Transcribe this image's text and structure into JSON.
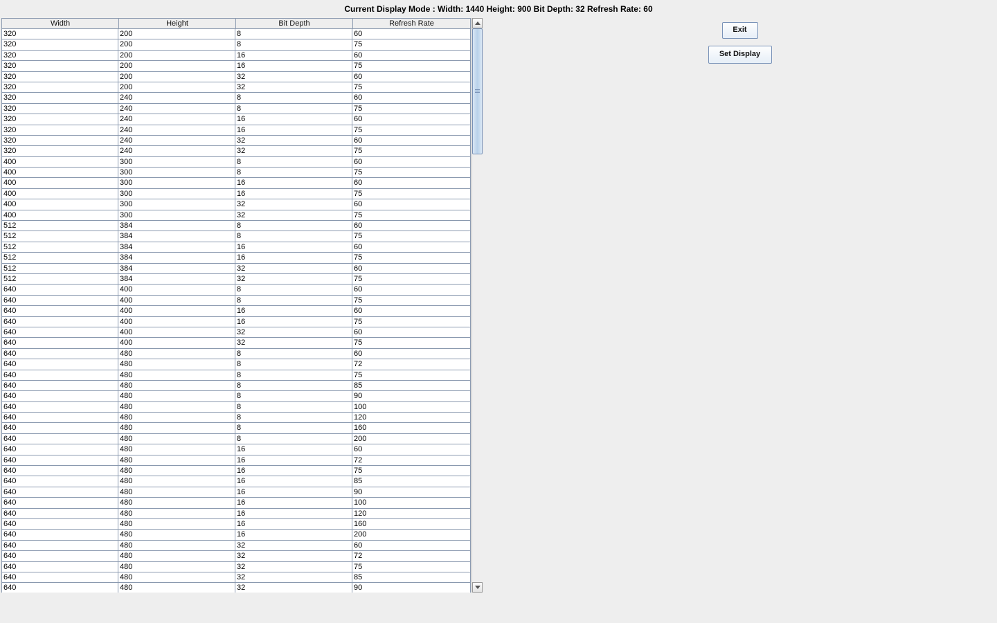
{
  "title": "Current Display Mode :   Width: 1440 Height: 900 Bit Depth: 32 Refresh Rate: 60",
  "buttons": {
    "exit": "Exit",
    "set_display": "Set Display"
  },
  "columns": [
    "Width",
    "Height",
    "Bit Depth",
    "Refresh Rate"
  ],
  "rows": [
    [
      "320",
      "200",
      "8",
      "60"
    ],
    [
      "320",
      "200",
      "8",
      "75"
    ],
    [
      "320",
      "200",
      "16",
      "60"
    ],
    [
      "320",
      "200",
      "16",
      "75"
    ],
    [
      "320",
      "200",
      "32",
      "60"
    ],
    [
      "320",
      "200",
      "32",
      "75"
    ],
    [
      "320",
      "240",
      "8",
      "60"
    ],
    [
      "320",
      "240",
      "8",
      "75"
    ],
    [
      "320",
      "240",
      "16",
      "60"
    ],
    [
      "320",
      "240",
      "16",
      "75"
    ],
    [
      "320",
      "240",
      "32",
      "60"
    ],
    [
      "320",
      "240",
      "32",
      "75"
    ],
    [
      "400",
      "300",
      "8",
      "60"
    ],
    [
      "400",
      "300",
      "8",
      "75"
    ],
    [
      "400",
      "300",
      "16",
      "60"
    ],
    [
      "400",
      "300",
      "16",
      "75"
    ],
    [
      "400",
      "300",
      "32",
      "60"
    ],
    [
      "400",
      "300",
      "32",
      "75"
    ],
    [
      "512",
      "384",
      "8",
      "60"
    ],
    [
      "512",
      "384",
      "8",
      "75"
    ],
    [
      "512",
      "384",
      "16",
      "60"
    ],
    [
      "512",
      "384",
      "16",
      "75"
    ],
    [
      "512",
      "384",
      "32",
      "60"
    ],
    [
      "512",
      "384",
      "32",
      "75"
    ],
    [
      "640",
      "400",
      "8",
      "60"
    ],
    [
      "640",
      "400",
      "8",
      "75"
    ],
    [
      "640",
      "400",
      "16",
      "60"
    ],
    [
      "640",
      "400",
      "16",
      "75"
    ],
    [
      "640",
      "400",
      "32",
      "60"
    ],
    [
      "640",
      "400",
      "32",
      "75"
    ],
    [
      "640",
      "480",
      "8",
      "60"
    ],
    [
      "640",
      "480",
      "8",
      "72"
    ],
    [
      "640",
      "480",
      "8",
      "75"
    ],
    [
      "640",
      "480",
      "8",
      "85"
    ],
    [
      "640",
      "480",
      "8",
      "90"
    ],
    [
      "640",
      "480",
      "8",
      "100"
    ],
    [
      "640",
      "480",
      "8",
      "120"
    ],
    [
      "640",
      "480",
      "8",
      "160"
    ],
    [
      "640",
      "480",
      "8",
      "200"
    ],
    [
      "640",
      "480",
      "16",
      "60"
    ],
    [
      "640",
      "480",
      "16",
      "72"
    ],
    [
      "640",
      "480",
      "16",
      "75"
    ],
    [
      "640",
      "480",
      "16",
      "85"
    ],
    [
      "640",
      "480",
      "16",
      "90"
    ],
    [
      "640",
      "480",
      "16",
      "100"
    ],
    [
      "640",
      "480",
      "16",
      "120"
    ],
    [
      "640",
      "480",
      "16",
      "160"
    ],
    [
      "640",
      "480",
      "16",
      "200"
    ],
    [
      "640",
      "480",
      "32",
      "60"
    ],
    [
      "640",
      "480",
      "32",
      "72"
    ],
    [
      "640",
      "480",
      "32",
      "75"
    ],
    [
      "640",
      "480",
      "32",
      "85"
    ],
    [
      "640",
      "480",
      "32",
      "90"
    ]
  ]
}
